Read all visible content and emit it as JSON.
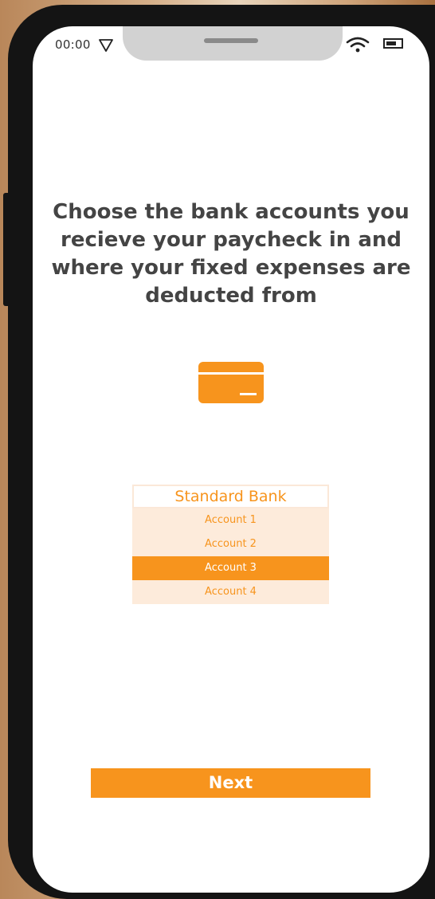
{
  "status_bar": {
    "time": "00:00"
  },
  "screen": {
    "title": "Choose the bank accounts you recieve your paycheck in and where your fixed expenses are deducted from",
    "icon": "credit-card-icon"
  },
  "bank_picker": {
    "bank_name": "Standard Bank",
    "accounts": [
      {
        "label": "Account 1",
        "selected": false
      },
      {
        "label": "Account 2",
        "selected": false
      },
      {
        "label": "Account 3",
        "selected": true
      },
      {
        "label": "Account 4",
        "selected": false
      }
    ]
  },
  "actions": {
    "next_label": "Next"
  },
  "colors": {
    "accent": "#f7941d",
    "option_background": "#fdebdb",
    "title_text": "#444444",
    "screen_background": "#ffffff",
    "device_frame": "#141414"
  }
}
